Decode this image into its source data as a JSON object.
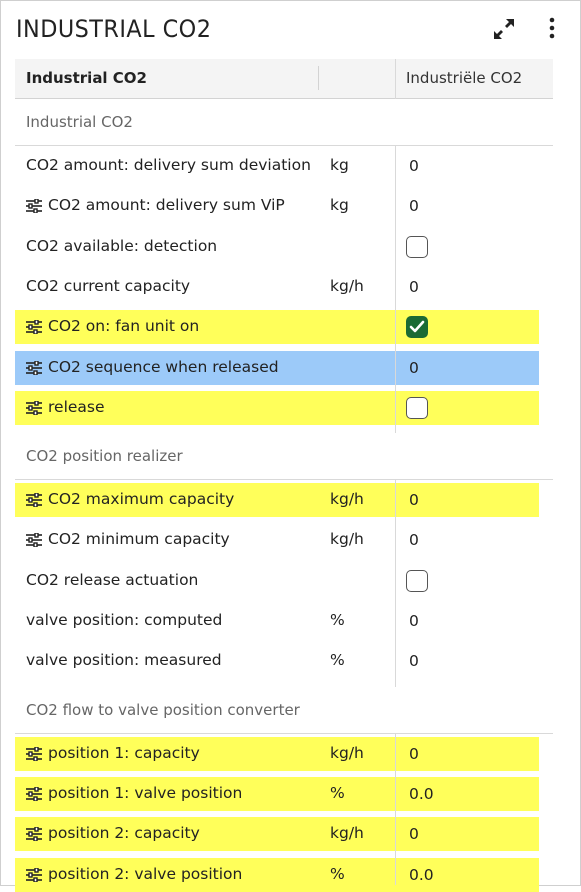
{
  "panel": {
    "title": "INDUSTRIAL CO2",
    "header_label": "Industrial CO2",
    "header_column": "Industriële CO2"
  },
  "sections": [
    {
      "label": "Industrial CO2",
      "rows": [
        {
          "label": "CO2 amount: delivery sum deviation",
          "unit": "kg",
          "value": "0",
          "type": "value",
          "tunable": false,
          "highlight": "none"
        },
        {
          "label": "CO2 amount: delivery sum ViP",
          "unit": "kg",
          "value": "0",
          "type": "value",
          "tunable": true,
          "highlight": "none"
        },
        {
          "label": "CO2 available: detection",
          "unit": "",
          "checked": false,
          "type": "checkbox",
          "tunable": false,
          "highlight": "none"
        },
        {
          "label": "CO2 current capacity",
          "unit": "kg/h",
          "value": "0",
          "type": "value",
          "tunable": false,
          "highlight": "none"
        },
        {
          "label": "CO2 on: fan unit on",
          "unit": "",
          "checked": true,
          "type": "checkbox",
          "tunable": true,
          "highlight": "yellow"
        },
        {
          "label": "CO2 sequence when released",
          "unit": "",
          "value": "0",
          "type": "value",
          "tunable": true,
          "highlight": "blue"
        },
        {
          "label": "release",
          "unit": "",
          "checked": false,
          "type": "checkbox",
          "tunable": true,
          "highlight": "yellow"
        }
      ]
    },
    {
      "label": "CO2 position realizer",
      "rows": [
        {
          "label": "CO2 maximum capacity",
          "unit": "kg/h",
          "value": "0",
          "type": "value",
          "tunable": true,
          "highlight": "yellow"
        },
        {
          "label": "CO2 minimum capacity",
          "unit": "kg/h",
          "value": "0",
          "type": "value",
          "tunable": true,
          "highlight": "none"
        },
        {
          "label": "CO2 release actuation",
          "unit": "",
          "checked": false,
          "type": "checkbox",
          "tunable": false,
          "highlight": "none"
        },
        {
          "label": "valve position: computed",
          "unit": "%",
          "value": "0",
          "type": "value",
          "tunable": false,
          "highlight": "none"
        },
        {
          "label": "valve position: measured",
          "unit": "%",
          "value": "0",
          "type": "value",
          "tunable": false,
          "highlight": "none"
        }
      ]
    },
    {
      "label": "CO2 flow to valve position converter",
      "rows": [
        {
          "label": "position 1: capacity",
          "unit": "kg/h",
          "value": "0",
          "type": "value",
          "tunable": true,
          "highlight": "yellow"
        },
        {
          "label": "position 1: valve position",
          "unit": "%",
          "value": "0.0",
          "type": "value",
          "tunable": true,
          "highlight": "yellow"
        },
        {
          "label": "position 2: capacity",
          "unit": "kg/h",
          "value": "0",
          "type": "value",
          "tunable": true,
          "highlight": "yellow"
        },
        {
          "label": "position 2: valve position",
          "unit": "%",
          "value": "0.0",
          "type": "value",
          "tunable": true,
          "highlight": "yellow"
        }
      ]
    }
  ],
  "icons": {
    "expand": "expand-arrows-icon",
    "more": "more-vertical-icon",
    "tune": "tune-sliders-icon",
    "check": "checkmark-icon"
  },
  "colors": {
    "yellow_highlight": "#ffff5a",
    "blue_highlight": "#9ccaf9",
    "checkbox_on": "#1b6b34"
  }
}
